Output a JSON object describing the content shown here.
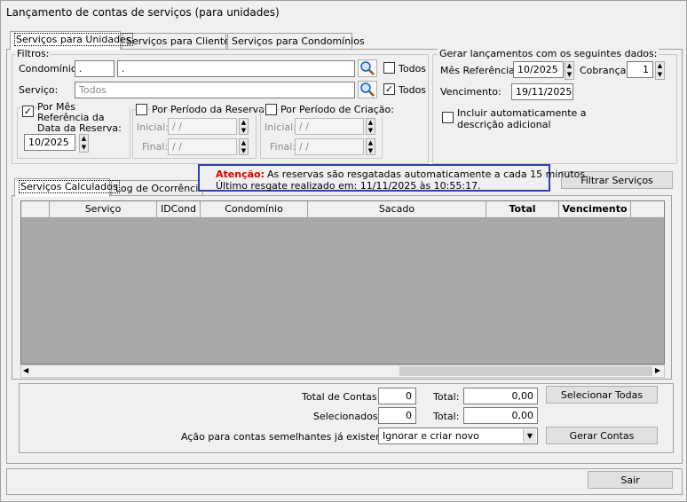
{
  "window": {
    "title": "Lançamento de contas de serviços (para unidades)"
  },
  "tabs": [
    {
      "label": "Serviços para Unidades"
    },
    {
      "label": "Serviços para Clientes"
    },
    {
      "label": "Serviços para Condomínios"
    }
  ],
  "filters": {
    "group_label": "Filtros:",
    "condominio_label": "Condomínio:",
    "condominio_code": ".",
    "condominio_name": ".",
    "todos_label": "Todos",
    "servico_label": "Serviço:",
    "servico_placeholder": "Todos",
    "mes_ref_label": "Por Mês Referência da Data da Reserva:",
    "mes_ref_value": "10/2025",
    "periodo_reserva_label": "Por Período da Reserva:",
    "periodo_criacao_label": "Por Período de Criação:",
    "inicial_label": "Inicial:",
    "final_label": "Final:",
    "empty_date": " / /"
  },
  "gerar": {
    "group_label": "Gerar lançamentos com os seguintes dados:",
    "mes_ref_label": "Mês Referência:",
    "mes_ref_value": "10/2025",
    "cobranca_label": "Cobrança:",
    "cobranca_value": "1",
    "vencimento_label": "Vencimento:",
    "vencimento_value": "19/11/2025",
    "incluir_label_1": "Incluir automaticamente a",
    "incluir_label_2": "descrição adicional"
  },
  "subtabs": [
    {
      "label": "Serviços Calculados"
    },
    {
      "label": "Log de Ocorrências"
    }
  ],
  "notice": {
    "attention": "Atenção:",
    "line1": "As reservas são resgatadas automaticamente a cada 15 minutos.",
    "line2": "Último resgate realizado em: 11/11/2025 às 10:55:17."
  },
  "filtrar_button": "Filtrar Serviços",
  "grid": {
    "columns": [
      "Serviço",
      "IDCond",
      "Condomínio",
      "Sacado",
      "Total",
      "Vencimento"
    ]
  },
  "totals": {
    "total_contas_label": "Total de Contas:",
    "total_contas_value": "0",
    "total_label": "Total:",
    "total_contas_sum": "0,00",
    "selecionados_label": "Selecionados:",
    "selecionados_value": "0",
    "selecionados_sum": "0,00",
    "acao_label": "Ação para contas semelhantes já existentes:",
    "acao_value": "Ignorar e criar novo",
    "selecionar_todas": "Selecionar Todas",
    "gerar_contas": "Gerar Contas"
  },
  "sair_button": "Sair",
  "colors": {
    "attention": "#e00000",
    "notice_border": "#2f3fae",
    "grid_bg": "#a9a9a9"
  }
}
